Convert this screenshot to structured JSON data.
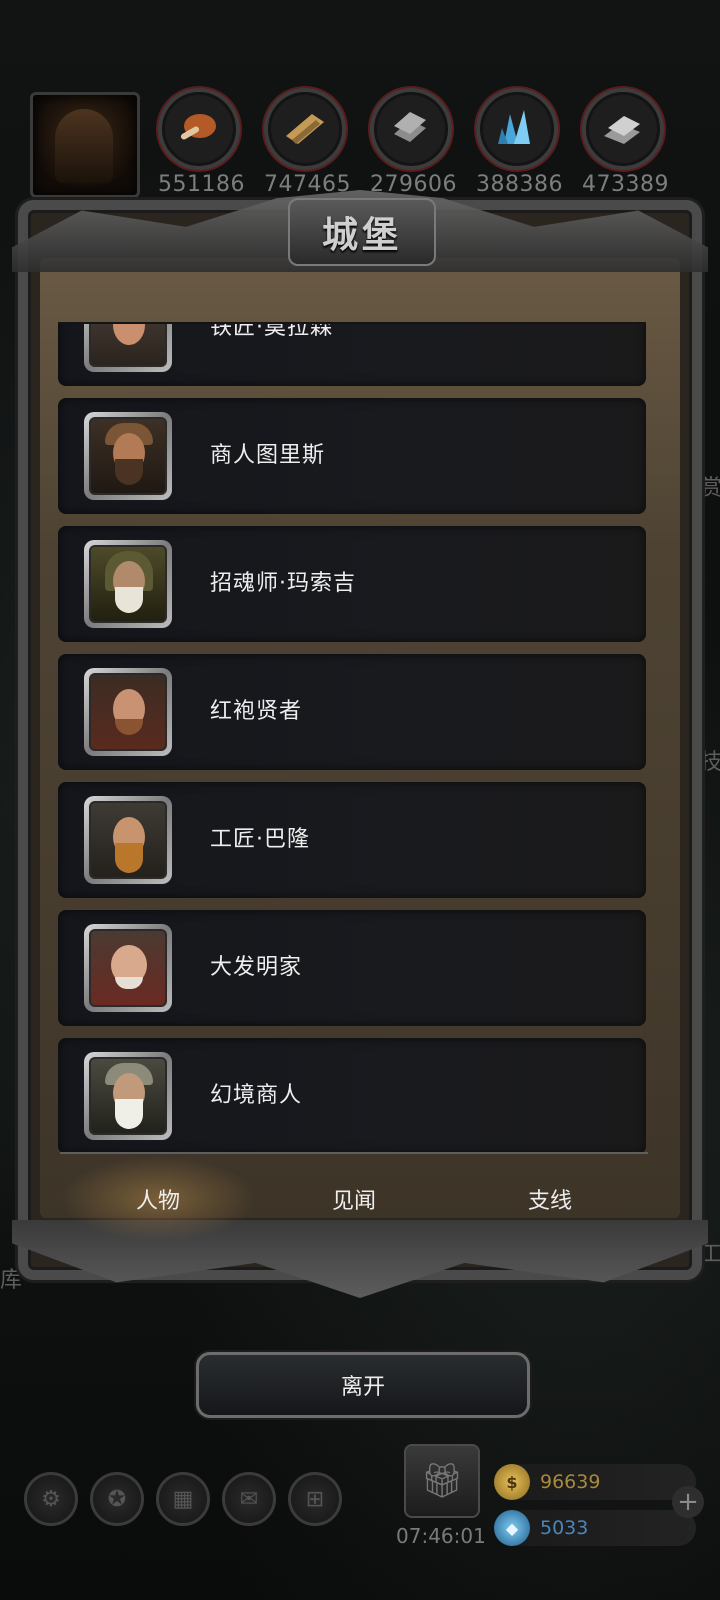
{
  "dialog": {
    "title": "城堡"
  },
  "resources": [
    {
      "name": "food-icon",
      "value": "551186",
      "color": "#b35a26"
    },
    {
      "name": "wood-icon",
      "value": "747465",
      "color": "#c49a55"
    },
    {
      "name": "iron-icon",
      "value": "279606",
      "color": "#8c8c8c"
    },
    {
      "name": "crystal-icon",
      "value": "388386",
      "color": "#4aa6d8"
    },
    {
      "name": "mithril-icon",
      "value": "473389",
      "color": "#bdbdbd"
    }
  ],
  "characters": [
    {
      "name": "铁匠·莫拉森",
      "portrait": "blacksmith-portrait-icon"
    },
    {
      "name": "商人图里斯",
      "portrait": "merchant-portrait-icon"
    },
    {
      "name": "招魂师·玛索吉",
      "portrait": "necromancer-portrait-icon"
    },
    {
      "name": "红袍贤者",
      "portrait": "red-robe-sage-portrait-icon"
    },
    {
      "name": "工匠·巴隆",
      "portrait": "dwarf-craftsman-portrait-icon"
    },
    {
      "name": "大发明家",
      "portrait": "inventor-portrait-icon"
    },
    {
      "name": "幻境商人",
      "portrait": "illusion-merchant-portrait-icon"
    }
  ],
  "tabs": [
    {
      "label": "人物",
      "active": true
    },
    {
      "label": "见闻",
      "active": false
    },
    {
      "label": "支线",
      "active": false
    }
  ],
  "leave_button": {
    "label": "离开"
  },
  "bottom": {
    "timer": "07:46:01",
    "gold": "96639",
    "gems": "5033",
    "plus": "+"
  },
  "edge_text": {
    "left_bottom": "库",
    "right_middle": "技",
    "right_bottom": "工",
    "right_upper": "赏"
  }
}
